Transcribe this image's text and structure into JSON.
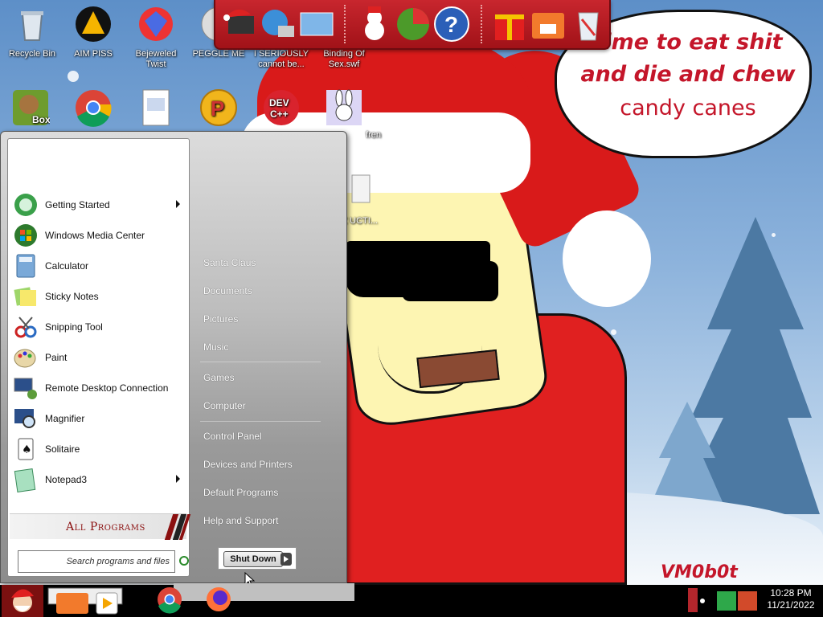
{
  "wallpaper": {
    "speech_line_1": "time to eat shit",
    "speech_line_2": "and die and chew",
    "speech_line_3": "candy canes",
    "signature": "VM0b0t"
  },
  "desktop_icons": [
    {
      "name": "recycle-bin",
      "label": "Recycle Bin"
    },
    {
      "name": "aim",
      "label": "AIM PISS"
    },
    {
      "name": "bejeweled",
      "label": "Bejeweled Twist"
    },
    {
      "name": "peggle",
      "label": "PEGGLE ME"
    },
    {
      "name": "i-seriously",
      "label": "I SERIOUSLY cannot be..."
    },
    {
      "name": "binding-of-sex",
      "label": "Binding Of Sex.swf"
    },
    {
      "name": "box",
      "label": ""
    },
    {
      "name": "chrome",
      "label": ""
    },
    {
      "name": "document",
      "label": ""
    },
    {
      "name": "p-app",
      "label": ""
    },
    {
      "name": "dev-cpp",
      "label": ""
    },
    {
      "name": "fren",
      "label": "fren"
    },
    {
      "name": "mz-file",
      "label": "MZ UCTI..."
    }
  ],
  "start_menu": {
    "programs": [
      {
        "label": "Getting Started",
        "has_submenu": true
      },
      {
        "label": "Windows Media Center",
        "has_submenu": false
      },
      {
        "label": "Calculator",
        "has_submenu": false
      },
      {
        "label": "Sticky Notes",
        "has_submenu": false
      },
      {
        "label": "Snipping Tool",
        "has_submenu": false
      },
      {
        "label": "Paint",
        "has_submenu": false
      },
      {
        "label": "Remote Desktop Connection",
        "has_submenu": false
      },
      {
        "label": "Magnifier",
        "has_submenu": false
      },
      {
        "label": "Solitaire",
        "has_submenu": false
      },
      {
        "label": "Notepad3",
        "has_submenu": true
      }
    ],
    "all_programs": "All Programs",
    "search_placeholder": "Search programs and files",
    "right_items": [
      "Santa Claus",
      "Documents",
      "Pictures",
      "Music",
      "Games",
      "Computer",
      "Control Panel",
      "Devices and Printers",
      "Default Programs",
      "Help and Support"
    ],
    "shutdown_label": "Shut Down"
  },
  "taskbar": {
    "time": "10:28 PM",
    "date": "11/21/2022"
  },
  "colors": {
    "accent_red": "#c4162a",
    "dock_red": "#b71c22"
  }
}
